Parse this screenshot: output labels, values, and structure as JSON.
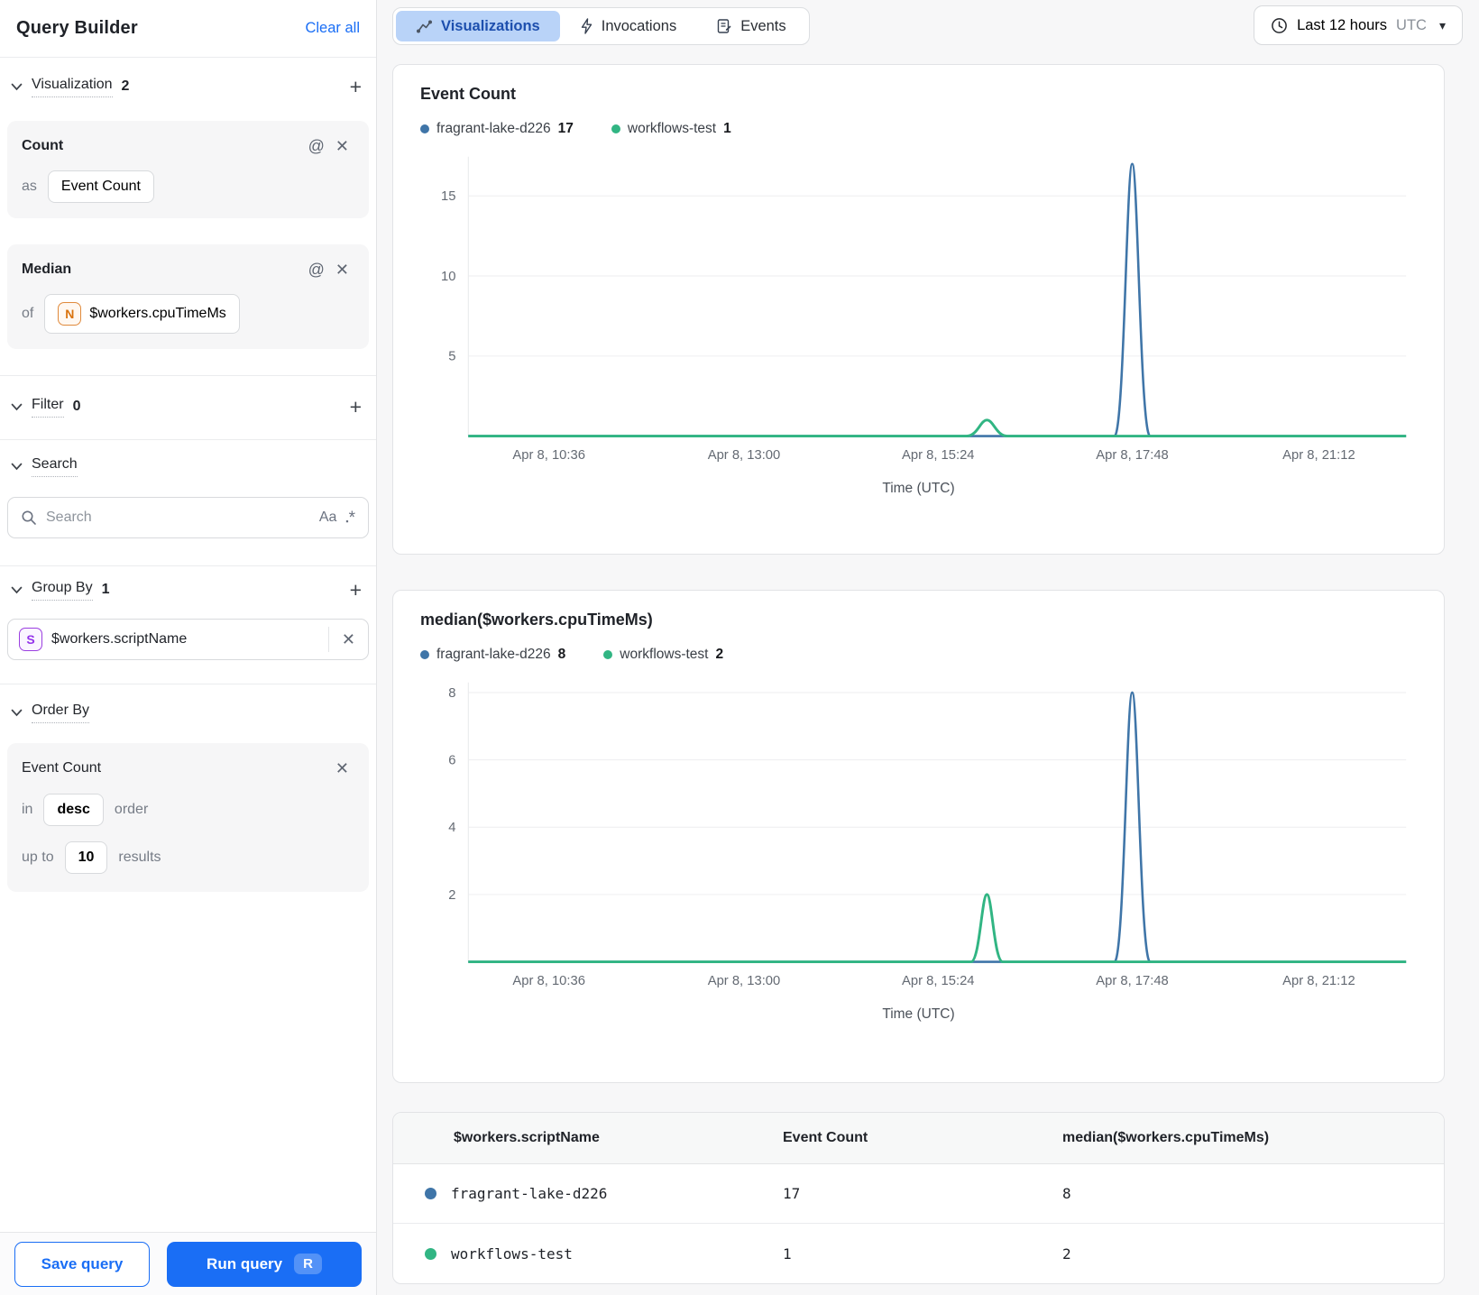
{
  "colors": {
    "accent_blue": "#1A6EF5",
    "active_tab_bg": "#B9D3F8",
    "active_tab_text": "#1D4FAE",
    "series_blue": "#3F75A8",
    "series_green": "#31B583"
  },
  "icons": {
    "at": "@",
    "close": "✕",
    "plus": "+",
    "caret_down": "▾",
    "case_sensitive": "Aa",
    "regex_square": "▪",
    "regex_star": "*"
  },
  "sidebar": {
    "title": "Query Builder",
    "clear_all": "Clear all",
    "visualization": {
      "label": "Visualization",
      "count": "2"
    },
    "cards": [
      {
        "title": "Count",
        "prefix": "as",
        "value": "Event Count"
      },
      {
        "title": "Median",
        "prefix": "of",
        "badge": "N",
        "value": "$workers.cpuTimeMs"
      }
    ],
    "filter": {
      "label": "Filter",
      "count": "0"
    },
    "search": {
      "label": "Search",
      "placeholder": "Search"
    },
    "group_by": {
      "label": "Group By",
      "count": "1",
      "item": {
        "badge": "S",
        "value": "$workers.scriptName"
      }
    },
    "order_by": {
      "label": "Order By",
      "field": "Event Count",
      "in_label": "in",
      "direction": "desc",
      "order_label": "order",
      "upto_label": "up to",
      "limit": "10",
      "results_label": "results"
    },
    "footer": {
      "save_label": "Save query",
      "run_label": "Run query",
      "run_shortcut": "R"
    }
  },
  "header": {
    "tabs": [
      {
        "label": "Visualizations",
        "active": true
      },
      {
        "label": "Invocations",
        "active": false
      },
      {
        "label": "Events",
        "active": false
      }
    ],
    "time_range": {
      "label": "Last 12 hours",
      "zone": "UTC"
    }
  },
  "chart_data": [
    {
      "type": "line",
      "title": "Event Count",
      "xlabel": "Time (UTC)",
      "legend": [
        {
          "name": "fragrant-lake-d226",
          "value": "17",
          "color_key": "series_blue"
        },
        {
          "name": "workflows-test",
          "value": "1",
          "color_key": "series_green"
        }
      ],
      "y_ticks": [
        5,
        10,
        15
      ],
      "ylim": [
        0,
        17.45
      ],
      "x_ticks": [
        {
          "label": "Apr 8, 10:36",
          "frac": 0.086
        },
        {
          "label": "Apr 8, 13:00",
          "frac": 0.294
        },
        {
          "label": "Apr 8, 15:24",
          "frac": 0.501
        },
        {
          "label": "Apr 8, 17:48",
          "frac": 0.708
        },
        {
          "label": "Apr 8, 21:12",
          "frac": 0.907
        }
      ],
      "series": [
        {
          "name": "fragrant-lake-d226",
          "color_key": "series_blue",
          "stroke_width": 2.6,
          "baseline": 0,
          "points": [
            [
              "Apr 8, 10:36",
              0
            ],
            [
              "Apr 8, 17:48",
              17
            ],
            [
              "Apr 8, 21:12",
              0
            ]
          ],
          "peak": {
            "frac": 0.708,
            "value": 17,
            "half_width_frac": 0.019
          }
        },
        {
          "name": "workflows-test",
          "color_key": "series_green",
          "stroke_width": 3,
          "baseline": 0,
          "points": [
            [
              "Apr 8, 10:36",
              0
            ],
            [
              "Apr 8, 16:00",
              1
            ],
            [
              "Apr 8, 21:12",
              0
            ]
          ],
          "peak": {
            "frac": 0.553,
            "value": 1,
            "half_width_frac": 0.022
          }
        }
      ]
    },
    {
      "type": "line",
      "title": "median($workers.cpuTimeMs)",
      "xlabel": "Time (UTC)",
      "legend": [
        {
          "name": "fragrant-lake-d226",
          "value": "8",
          "color_key": "series_blue"
        },
        {
          "name": "workflows-test",
          "value": "2",
          "color_key": "series_green"
        }
      ],
      "y_ticks": [
        2,
        4,
        6,
        8
      ],
      "ylim": [
        0,
        8.3
      ],
      "x_ticks": [
        {
          "label": "Apr 8, 10:36",
          "frac": 0.086
        },
        {
          "label": "Apr 8, 13:00",
          "frac": 0.294
        },
        {
          "label": "Apr 8, 15:24",
          "frac": 0.501
        },
        {
          "label": "Apr 8, 17:48",
          "frac": 0.708
        },
        {
          "label": "Apr 8, 21:12",
          "frac": 0.907
        }
      ],
      "series": [
        {
          "name": "fragrant-lake-d226",
          "color_key": "series_blue",
          "stroke_width": 2.6,
          "baseline": 0,
          "points": [
            [
              "Apr 8, 10:36",
              0
            ],
            [
              "Apr 8, 17:48",
              8
            ],
            [
              "Apr 8, 21:12",
              0
            ]
          ],
          "peak": {
            "frac": 0.708,
            "value": 8,
            "half_width_frac": 0.019
          }
        },
        {
          "name": "workflows-test",
          "color_key": "series_green",
          "stroke_width": 3,
          "baseline": 0,
          "points": [
            [
              "Apr 8, 10:36",
              0
            ],
            [
              "Apr 8, 16:00",
              2
            ],
            [
              "Apr 8, 21:12",
              0
            ]
          ],
          "peak": {
            "frac": 0.553,
            "value": 2,
            "half_width_frac": 0.017
          }
        }
      ]
    }
  ],
  "table": {
    "columns": [
      "$workers.scriptName",
      "Event Count",
      "median($workers.cpuTimeMs)"
    ],
    "rows": [
      {
        "color_key": "series_blue",
        "name": "fragrant-lake-d226",
        "event_count": "17",
        "median": "8"
      },
      {
        "color_key": "series_green",
        "name": "workflows-test",
        "event_count": "1",
        "median": "2"
      }
    ]
  }
}
